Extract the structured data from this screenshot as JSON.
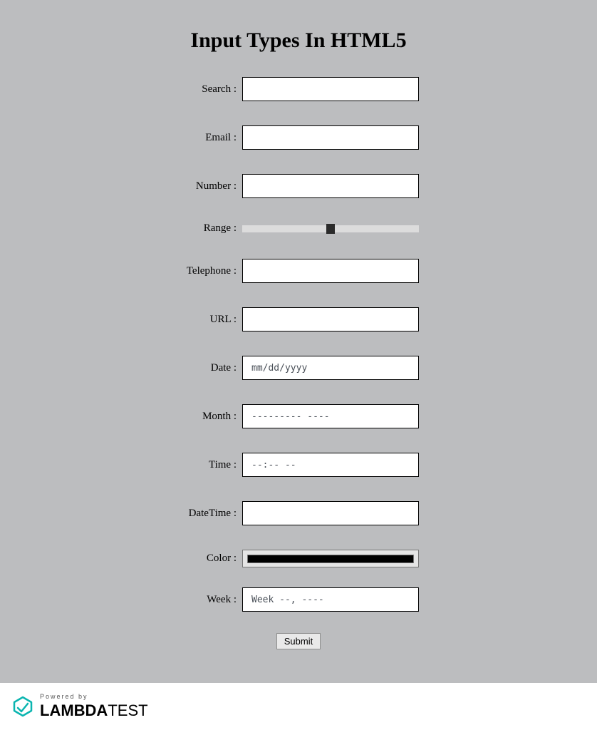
{
  "heading": "Input Types In HTML5",
  "fields": {
    "search": {
      "label": "Search :",
      "value": ""
    },
    "email": {
      "label": "Email :",
      "value": ""
    },
    "number": {
      "label": "Number :",
      "value": ""
    },
    "range": {
      "label": "Range :",
      "value": 50
    },
    "telephone": {
      "label": "Telephone :",
      "value": ""
    },
    "url": {
      "label": "URL :",
      "value": ""
    },
    "date": {
      "label": "Date :",
      "placeholder": "mm/dd/yyyy"
    },
    "month": {
      "label": "Month :",
      "placeholder": "--------- ----"
    },
    "time": {
      "label": "Time :",
      "placeholder": "--:-- --"
    },
    "datetime": {
      "label": "DateTime :",
      "value": ""
    },
    "color": {
      "label": "Color :",
      "value": "#000000"
    },
    "week": {
      "label": "Week :",
      "placeholder": "Week --, ----"
    }
  },
  "submit_label": "Submit",
  "footer": {
    "powered_by": "Powered by",
    "brand_bold": "LAMBDA",
    "brand_light": "TEST"
  }
}
